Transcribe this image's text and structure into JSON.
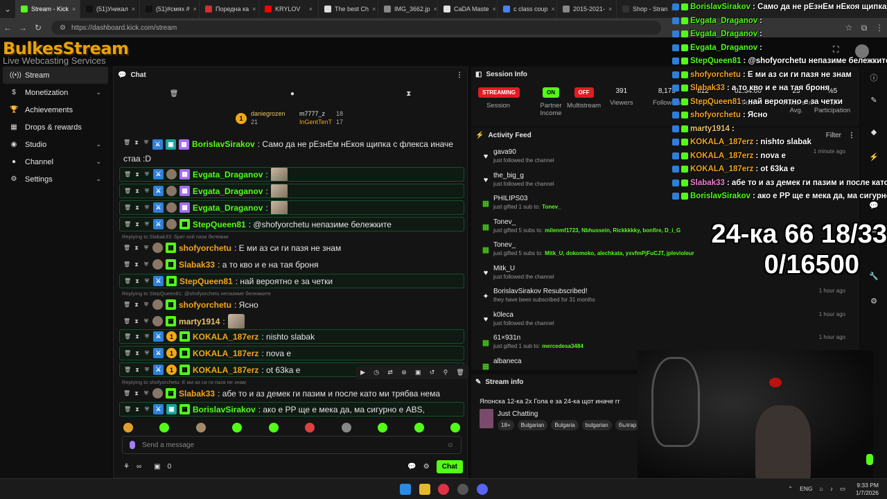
{
  "browser": {
    "tabs": [
      {
        "label": "Stream - Kick",
        "color": "#53fc18"
      },
      {
        "label": "(51)Уникал",
        "color": "#111111"
      },
      {
        "label": "(51)#смях #",
        "color": "#111111"
      },
      {
        "label": "Поредна ка",
        "color": "#d32f2f"
      },
      {
        "label": "KRYLOV",
        "color": "#ff0000"
      },
      {
        "label": "The best Ch",
        "color": "#dddddd"
      },
      {
        "label": "IMG_3662.jp",
        "color": "#888888"
      },
      {
        "label": "CaDA Maste",
        "color": "#e0e0e0"
      },
      {
        "label": "c class coup",
        "color": "#4285f4"
      },
      {
        "label": "2015-2021-",
        "color": "#888888"
      },
      {
        "label": "Shop - Stran",
        "color": "#333333"
      }
    ],
    "url": "https://dashboard.kick.com/stream"
  },
  "logo": {
    "line1": "BulkesStream",
    "line2": "Live Webcasting Services"
  },
  "sidebar": {
    "items": [
      {
        "label": "Stream",
        "icon": "broadcast-icon",
        "glyph": "((•))",
        "active": true,
        "chevron": false
      },
      {
        "label": "Monetization",
        "icon": "dollar-icon",
        "glyph": "$",
        "active": false,
        "chevron": true
      },
      {
        "label": "Achievements",
        "icon": "trophy-icon",
        "glyph": "🏆",
        "active": false,
        "chevron": false
      },
      {
        "label": "Drops & rewards",
        "icon": "gift-icon",
        "glyph": "▦",
        "active": false,
        "chevron": false
      },
      {
        "label": "Studio",
        "icon": "studio-icon",
        "glyph": "◉",
        "active": false,
        "chevron": true
      },
      {
        "label": "Channel",
        "icon": "person-icon",
        "glyph": "●",
        "active": false,
        "chevron": true
      },
      {
        "label": "Settings",
        "icon": "gear-icon",
        "glyph": "⚙",
        "active": false,
        "chevron": true
      }
    ]
  },
  "chat": {
    "title": "Chat",
    "leaders": [
      {
        "rank": "1",
        "name": "daniegrozen",
        "count": "21"
      },
      {
        "name": "m7777_z",
        "count": "18"
      },
      {
        "name": "InGentTenT",
        "count": "17"
      }
    ],
    "messages": [
      {
        "user": "BorislavSirakov",
        "color": "c-green",
        "text": ": Само да не рЕзнЕм нЕкоя щипка с флекса иначе",
        "text2": "стаа :D",
        "boxed": false
      },
      {
        "user": "Evgata_Draganov",
        "color": "c-green",
        "text": ":",
        "boxed": true
      },
      {
        "user": "Evgata_Draganov",
        "color": "c-green",
        "text": ":",
        "boxed": true
      },
      {
        "user": "Evgata_Draganov",
        "color": "c-green",
        "text": ":",
        "boxed": true
      },
      {
        "user": "StepQueen81",
        "color": "c-green",
        "text": ": @shofyorchetu непазиме бележките",
        "boxed": true
      },
      {
        "user": "shofyorchetu",
        "color": "c-orange",
        "text": ": Е ми аз си ги пазя не знам",
        "boxed": false
      },
      {
        "user": "Slabak33",
        "color": "c-orange",
        "text": ": а то кво и е на тая броня",
        "boxed": false
      },
      {
        "user": "StepQueen81",
        "color": "c-orange",
        "text": ": най вероятно е за четки",
        "boxed": true
      },
      {
        "user": "shofyorchetu",
        "color": "c-orange",
        "text": ": Ясно",
        "boxed": false
      },
      {
        "user": "marty1914",
        "color": "c-yellow",
        "text": ":",
        "boxed": false
      },
      {
        "user": "KOKALA_187erz",
        "color": "c-orange",
        "text": ": nishto slabak",
        "boxed": true
      },
      {
        "user": "KOKALA_187erz",
        "color": "c-orange",
        "text": ": nova e",
        "boxed": true
      },
      {
        "user": "KOKALA_187erz",
        "color": "c-orange",
        "text": ": ot 63ka e",
        "boxed": true
      },
      {
        "user": "Slabak33",
        "color": "c-orange",
        "text": ": абе то и аз демек ги пазим и после като ми трябва нема",
        "boxed": false
      },
      {
        "user": "BorislavSirakov",
        "color": "c-green",
        "text": ": ако е PP ще е мека да, ма сигурно е ABS,",
        "boxed": true
      }
    ],
    "replies": [
      "Replying to Slabak33: брат кой пази бележки",
      "Replying to StepQueen81: @shofyorchetu непазиме бележките",
      "Replying to shofyorchetu: Е ми аз си ги пазя не знам"
    ],
    "send_placeholder": "Send a message",
    "viewers_icon": "∞",
    "points": "0",
    "chat_button": "Chat"
  },
  "session": {
    "title": "Session Info",
    "stats": [
      {
        "kind": "pill",
        "value": "STREAMING",
        "pill": "red",
        "label": "Session"
      },
      {
        "kind": "pill",
        "value": "ON",
        "pill": "green",
        "label": "Partner Income"
      },
      {
        "kind": "pill",
        "value": "OFF",
        "pill": "red",
        "label": "Multistream"
      },
      {
        "kind": "num",
        "value": "391",
        "label": "Viewers"
      },
      {
        "kind": "num",
        "value": "8,175",
        "label": "Followers"
      },
      {
        "kind": "num",
        "value": "812",
        "label": "Sub"
      },
      {
        "kind": "num",
        "value": "02:34:00",
        "label": "Time"
      },
      {
        "kind": "num",
        "value": "23",
        "label": "Chatters In Avg."
      },
      {
        "kind": "num",
        "value": "%5",
        "label": "% Participation"
      }
    ]
  },
  "activity": {
    "title": "Activity Feed",
    "filter": "Filter",
    "items": [
      {
        "name": "gava90",
        "desc": "just followed the channel",
        "time": "1 minute ago",
        "icon": "heart-icon",
        "glyph": "♥"
      },
      {
        "name": "the_big_g",
        "desc": "just followed the channel",
        "time": "",
        "icon": "heart-icon",
        "glyph": "♥"
      },
      {
        "name": "PHILIPS03",
        "desc": "just gifted 1 sub to:",
        "extra": "Tonev_",
        "time": "",
        "icon": "gift-icon",
        "glyph": "▦"
      },
      {
        "name": "Tonev_",
        "desc": "just gifted 5 subs to:",
        "extra": "milenmf1723, Nbhussein, Rickkkkky, bonfire, D_i_G",
        "time": "",
        "icon": "gift-icon",
        "glyph": "▦"
      },
      {
        "name": "Tonev_",
        "desc": "just gifted 5 subs to:",
        "extra": "Mitk_U, dokomoko, alechkata, yxvfmPjFuCJT, jplevioleur",
        "time": "",
        "icon": "gift-icon",
        "glyph": "▦"
      },
      {
        "name": "Mitk_U",
        "desc": "just followed the channel",
        "time": "",
        "icon": "heart-icon",
        "glyph": "♥"
      },
      {
        "name": "BorislavSirakov Resubscribed!",
        "desc": "they have been subscribed for 31 months",
        "time": "1 hour ago",
        "icon": "star-icon",
        "glyph": "✦"
      },
      {
        "name": "k0leca",
        "desc": "just followed the channel",
        "time": "1 hour ago",
        "icon": "heart-icon",
        "glyph": "♥"
      },
      {
        "name": "61×931n",
        "desc": "just gifted 1 sub to:",
        "extra": "mercedesa3484",
        "time": "1 hour ago",
        "icon": "gift-icon",
        "glyph": "▦"
      },
      {
        "name": "albaneca",
        "desc": "",
        "time": "",
        "icon": "gift-icon",
        "glyph": "▦"
      }
    ]
  },
  "stream_info": {
    "title": "Stream info",
    "stream_title": "Японска 12-ка 2х Гола е за 24-ка щот иначе гг",
    "category": "Just Chatting",
    "tags": [
      "18+",
      "Bulgarian",
      "Bulgaria",
      "bulgarian",
      "българ"
    ]
  },
  "overlay_chat": [
    {
      "user": "BorislavSirakov",
      "text": ": Само да не рЕзнЕм нЕкоя щипка с флек",
      "color": "#53fc18"
    },
    {
      "user": "Evgata_Draganov",
      "text": ":",
      "color": "#53fc18"
    },
    {
      "user": "Evgata_Draganov",
      "text": ":",
      "color": "#53fc18"
    },
    {
      "user": "Evgata_Draganov",
      "text": ":",
      "color": "#53fc18"
    },
    {
      "user": "StepQueen81",
      "text": ": @shofyorchetu непазиме бележките",
      "color": "#53fc18"
    },
    {
      "user": "shofyorchetu",
      "text": ": Е ми аз си ги пазя не знам",
      "color": "#f2a51a"
    },
    {
      "user": "Slabak33",
      "text": ": а то кво и е на тая броня",
      "color": "#f2a51a"
    },
    {
      "user": "StepQueen81",
      "text": ": най вероятно е за четки",
      "color": "#f2a51a"
    },
    {
      "user": "shofyorchetu",
      "text": ": Ясно",
      "color": "#f2a51a"
    },
    {
      "user": "marty1914",
      "text": ":",
      "color": "#e9c26b"
    },
    {
      "user": "KOKALA_187erz",
      "text": ": nishto slabak",
      "color": "#f2a51a"
    },
    {
      "user": "KOKALA_187erz",
      "text": ": nova e",
      "color": "#f2a51a"
    },
    {
      "user": "KOKALA_187erz",
      "text": ": ot 63ka e",
      "color": "#f2a51a"
    },
    {
      "user": "Slabak33",
      "text": ": абе то и аз демек ги пазим и после като ми тре",
      "color": "#f07fd3"
    },
    {
      "user": "BorislavSirakov",
      "text": ": ако е PP ще е мека да, ма сигурно е А",
      "color": "#53fc18"
    }
  ],
  "big_overlay": {
    "line1": "24-ка 66 18/33",
    "line2": "0/16500"
  },
  "taskbar": {
    "lang": "ENG",
    "time": "9:33 PM",
    "date": "1/7/2026"
  }
}
